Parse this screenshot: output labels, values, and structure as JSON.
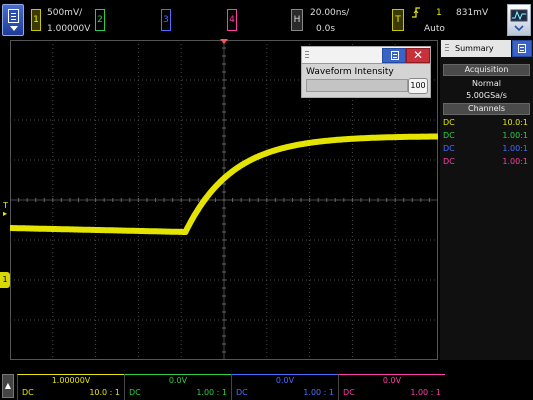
{
  "colors": {
    "ch1": "#e6e600",
    "ch2": "#2ecc40",
    "ch3": "#4a6cff",
    "ch4": "#ff3da8",
    "trigger": "#e6e600",
    "trace": "#f0f000",
    "grid": "#4a4a4a"
  },
  "topbar": {
    "menu_icon": "document-menu-icon",
    "ch1": {
      "num": "1",
      "scale": "500mV/",
      "offset": "1.00000V"
    },
    "ch2": {
      "num": "2"
    },
    "ch3": {
      "num": "3"
    },
    "ch4": {
      "num": "4"
    },
    "horizontal": {
      "label": "H",
      "scale": "20.00ns/",
      "delay": "0.0s"
    },
    "trigger": {
      "label": "T",
      "slope_icon": "rising-edge-icon",
      "source": "1",
      "level": "831mV",
      "mode": "Auto"
    },
    "waveform_icon": "waveform-screen-icon"
  },
  "screen": {
    "trigger_level_marker": "T",
    "ch1_ground_marker": "1",
    "trace": {
      "type": "line",
      "x_range_divisions": [
        -5,
        5
      ],
      "y_range_divisions": [
        -4,
        4
      ],
      "baseline_div": -0.8,
      "final_div": 1.6,
      "edge_start_div": -0.9,
      "edge_end_div": 1.1
    }
  },
  "dialog": {
    "title_help_icon": "help-document-icon",
    "close_label": "✕",
    "label": "Waveform Intensity",
    "value": "100"
  },
  "panel": {
    "tab_label": "Summary",
    "tab_icon": "panel-document-icon",
    "acquisition": {
      "heading": "Acquisition",
      "mode": "Normal",
      "rate": "5.00GSa/s"
    },
    "channels": {
      "heading": "Channels",
      "rows": [
        {
          "coupling": "DC",
          "ratio": "10.0:1"
        },
        {
          "coupling": "DC",
          "ratio": "1.00:1"
        },
        {
          "coupling": "DC",
          "ratio": "1.00:1"
        },
        {
          "coupling": "DC",
          "ratio": "1.00:1"
        }
      ]
    }
  },
  "bottombar": {
    "up_label": "▲",
    "ch1": {
      "level": "1.00000V",
      "coupling": "DC",
      "ratio": "10.0 : 1"
    },
    "ch2": {
      "level": "0.0V",
      "coupling": "DC",
      "ratio": "1.00 : 1"
    },
    "ch3": {
      "level": "0.0V",
      "coupling": "DC",
      "ratio": "1.00 : 1"
    },
    "ch4": {
      "level": "0.0V",
      "coupling": "DC",
      "ratio": "1.00 : 1"
    }
  }
}
